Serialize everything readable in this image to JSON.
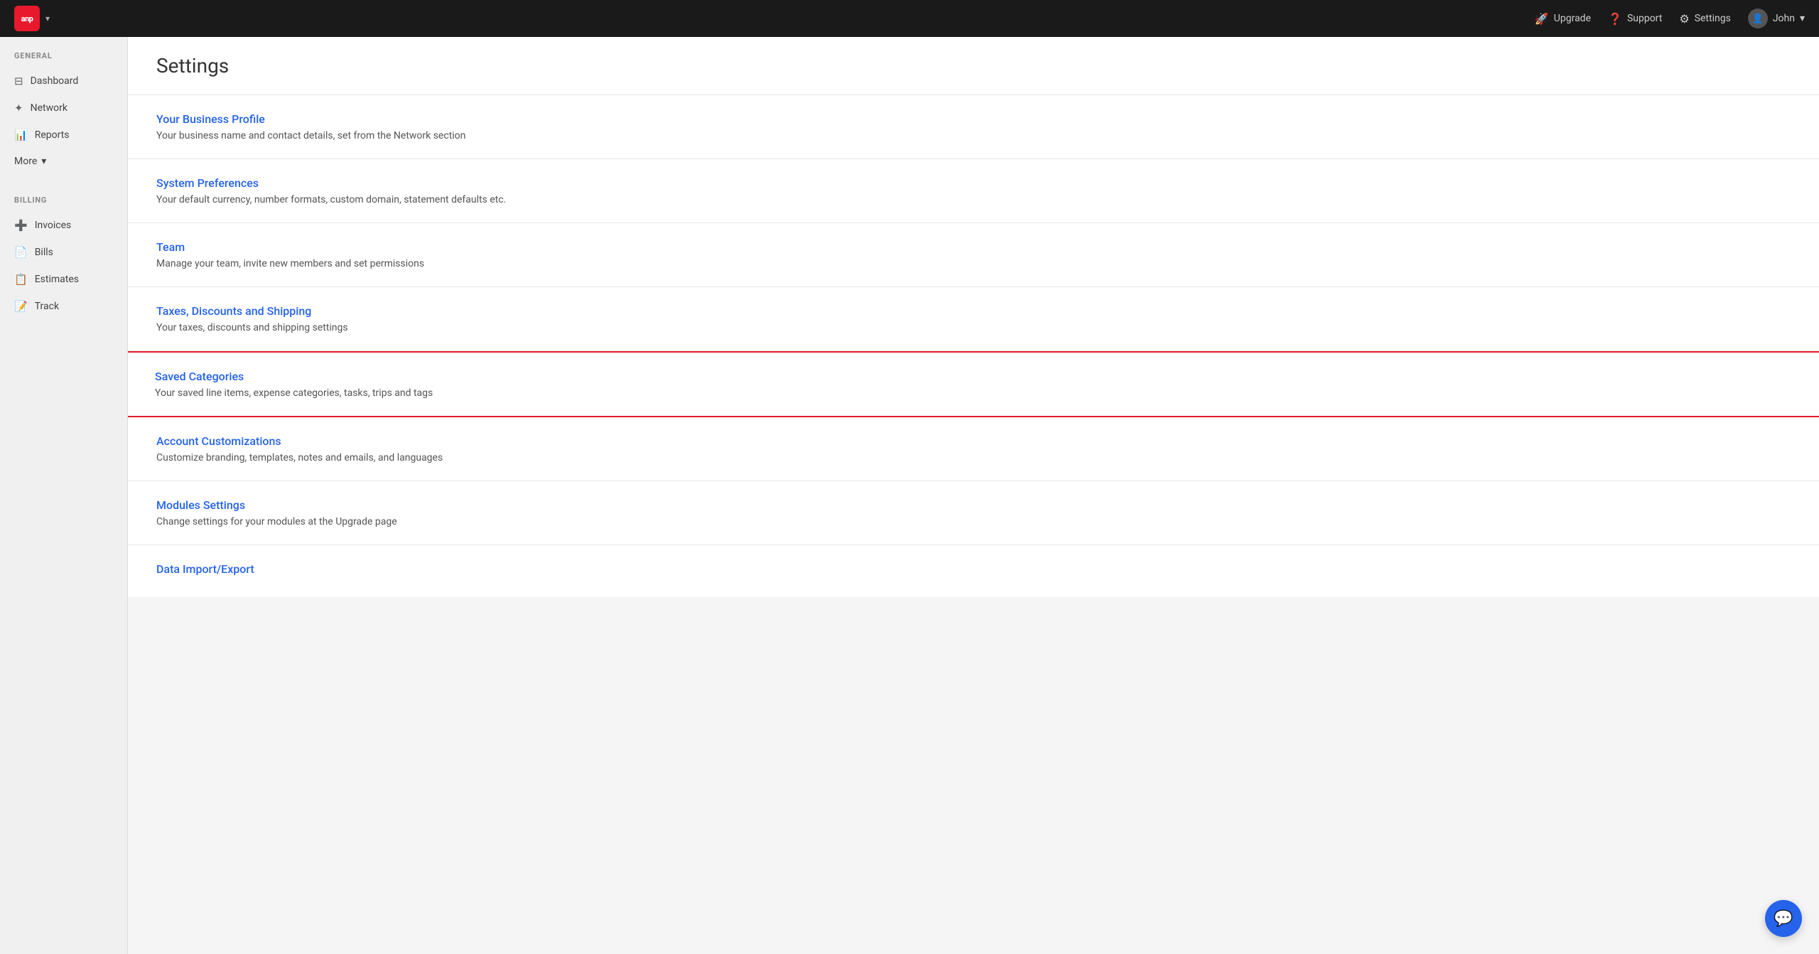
{
  "app": {
    "logo_text": "anp",
    "logo_chevron": "▾"
  },
  "top_nav": {
    "upgrade_label": "Upgrade",
    "upgrade_icon": "🚀",
    "support_label": "Support",
    "support_icon": "❓",
    "settings_label": "Settings",
    "settings_icon": "⚙",
    "user_label": "John",
    "user_chevron": "▾"
  },
  "sidebar": {
    "general_label": "GENERAL",
    "billing_label": "BILLING",
    "items_general": [
      {
        "id": "dashboard",
        "label": "Dashboard",
        "icon": "⊟"
      },
      {
        "id": "network",
        "label": "Network",
        "icon": "✦"
      },
      {
        "id": "reports",
        "label": "Reports",
        "icon": "📊"
      }
    ],
    "more_label": "More",
    "items_billing": [
      {
        "id": "invoices",
        "label": "Invoices",
        "icon": "➕"
      },
      {
        "id": "bills",
        "label": "Bills",
        "icon": "📄"
      },
      {
        "id": "estimates",
        "label": "Estimates",
        "icon": "📋"
      },
      {
        "id": "track",
        "label": "Track",
        "icon": "📝"
      }
    ]
  },
  "page": {
    "title": "Settings"
  },
  "settings_items": [
    {
      "id": "business-profile",
      "title": "Your Business Profile",
      "desc": "Your business name and contact details, set from the Network section",
      "highlighted": false
    },
    {
      "id": "system-preferences",
      "title": "System Preferences",
      "desc": "Your default currency, number formats, custom domain, statement defaults etc.",
      "highlighted": false
    },
    {
      "id": "team",
      "title": "Team",
      "desc": "Manage your team, invite new members and set permissions",
      "highlighted": false
    },
    {
      "id": "taxes-discounts-shipping",
      "title": "Taxes, Discounts and Shipping",
      "desc": "Your taxes, discounts and shipping settings",
      "highlighted": false
    },
    {
      "id": "saved-categories",
      "title": "Saved Categories",
      "desc": "Your saved line items, expense categories, tasks, trips and tags",
      "highlighted": true
    },
    {
      "id": "account-customizations",
      "title": "Account Customizations",
      "desc": "Customize branding, templates, notes and emails, and languages",
      "highlighted": false
    },
    {
      "id": "modules-settings",
      "title": "Modules Settings",
      "desc": "Change settings for your modules at the Upgrade page",
      "highlighted": false
    },
    {
      "id": "data-import-export",
      "title": "Data Import/Export",
      "desc": "",
      "highlighted": false
    }
  ],
  "chat": {
    "icon": "💬"
  }
}
